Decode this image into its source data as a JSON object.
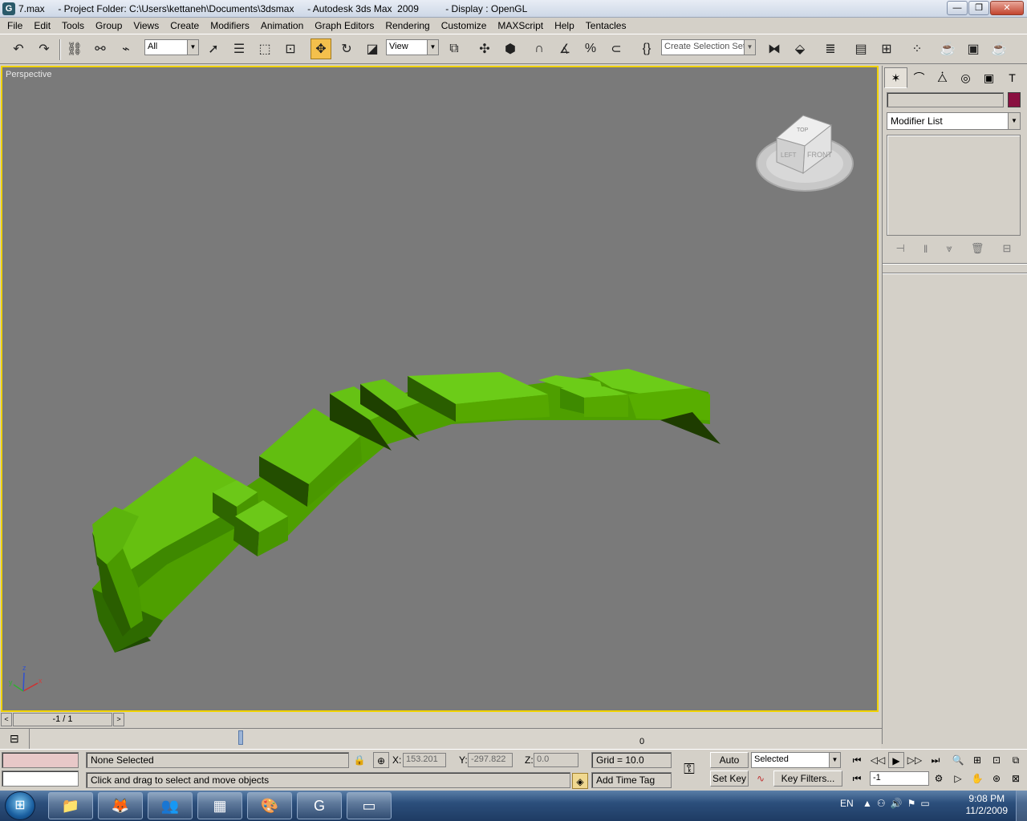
{
  "window": {
    "title": "7.max     - Project Folder: C:\\Users\\kettaneh\\Documents\\3dsmax     - Autodesk 3ds Max  2009          - Display : OpenGL",
    "minimize": "—",
    "maximize": "❐",
    "close": "✕"
  },
  "menu": [
    "File",
    "Edit",
    "Tools",
    "Group",
    "Views",
    "Create",
    "Modifiers",
    "Animation",
    "Graph Editors",
    "Rendering",
    "Customize",
    "MAXScript",
    "Help",
    "Tentacles"
  ],
  "toolbar": {
    "selection_filter": "All",
    "reference_coord": "View",
    "named_selection_placeholder": "Create Selection Set"
  },
  "viewport": {
    "label": "Perspective",
    "viewcube": {
      "top": "TOP",
      "left": "LEFT",
      "front": "FRONT"
    },
    "axis": {
      "x": "x",
      "y": "y",
      "z": "z"
    },
    "model_color": "#58b000"
  },
  "command_panel": {
    "modifier_list": "Modifier List",
    "object_color": "#8a1040"
  },
  "time_slider": {
    "frame": "-1 / 1",
    "prev": "<",
    "next": ">"
  },
  "track_bar": {
    "marker_label": "-1",
    "zero_label": "0"
  },
  "status": {
    "selection": "None Selected",
    "prompt": "Click and drag to select and move objects",
    "x_label": "X:",
    "x_value": "153.201",
    "y_label": "Y:",
    "y_value": "-297.822",
    "z_label": "Z:",
    "z_value": "0.0",
    "grid": "Grid = 10.0",
    "add_time_tag": "Add Time Tag",
    "auto_key": "Auto Key",
    "set_key": "Set Key",
    "key_mode": "Selected",
    "key_filters": "Key Filters...",
    "current_frame": "-1"
  },
  "taskbar": {
    "language": "EN",
    "time": "9:08 PM",
    "date": "11/2/2009"
  }
}
